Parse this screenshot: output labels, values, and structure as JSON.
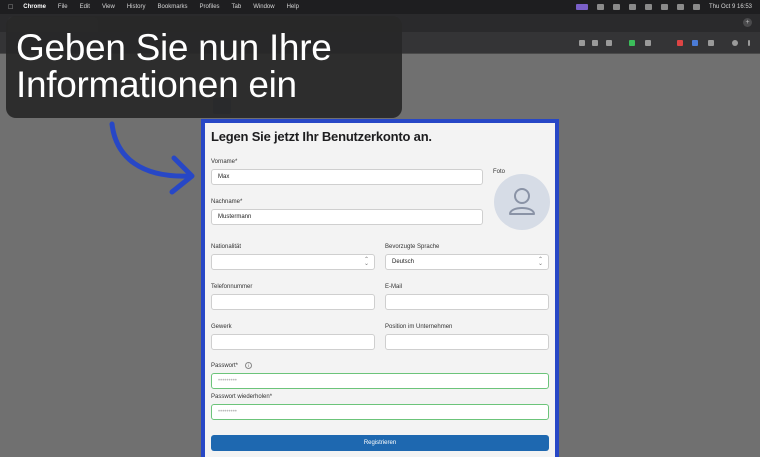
{
  "menubar": {
    "items": [
      "Chrome",
      "File",
      "Edit",
      "View",
      "History",
      "Bookmarks",
      "Profiles",
      "Tab",
      "Window",
      "Help"
    ],
    "clock": "Thu Oct 9  16:53"
  },
  "caption": {
    "line1": "Geben Sie nun Ihre",
    "line2": "Informationen ein"
  },
  "form": {
    "title": "Legen Sie jetzt Ihr Benutzerkonto an.",
    "vorname_label": "Vorname*",
    "vorname_value": "Max",
    "nachname_label": "Nachname*",
    "nachname_value": "Mustermann",
    "foto_label": "Foto",
    "nationalitaet_label": "Nationalität",
    "sprache_label": "Bevorzugte Sprache",
    "sprache_value": "Deutsch",
    "telefon_label": "Telefonnummer",
    "email_label": "E-Mail",
    "gewerk_label": "Gewerk",
    "position_label": "Position im Unternehmen",
    "passwort_label": "Passwort*",
    "passwort_repeat_label": "Passwort wiederholen*",
    "submit_label": "Registrieren"
  },
  "colors": {
    "card_border": "#2747c6",
    "submit_bg": "#1e68b0",
    "valid_border": "#6cc47a"
  }
}
